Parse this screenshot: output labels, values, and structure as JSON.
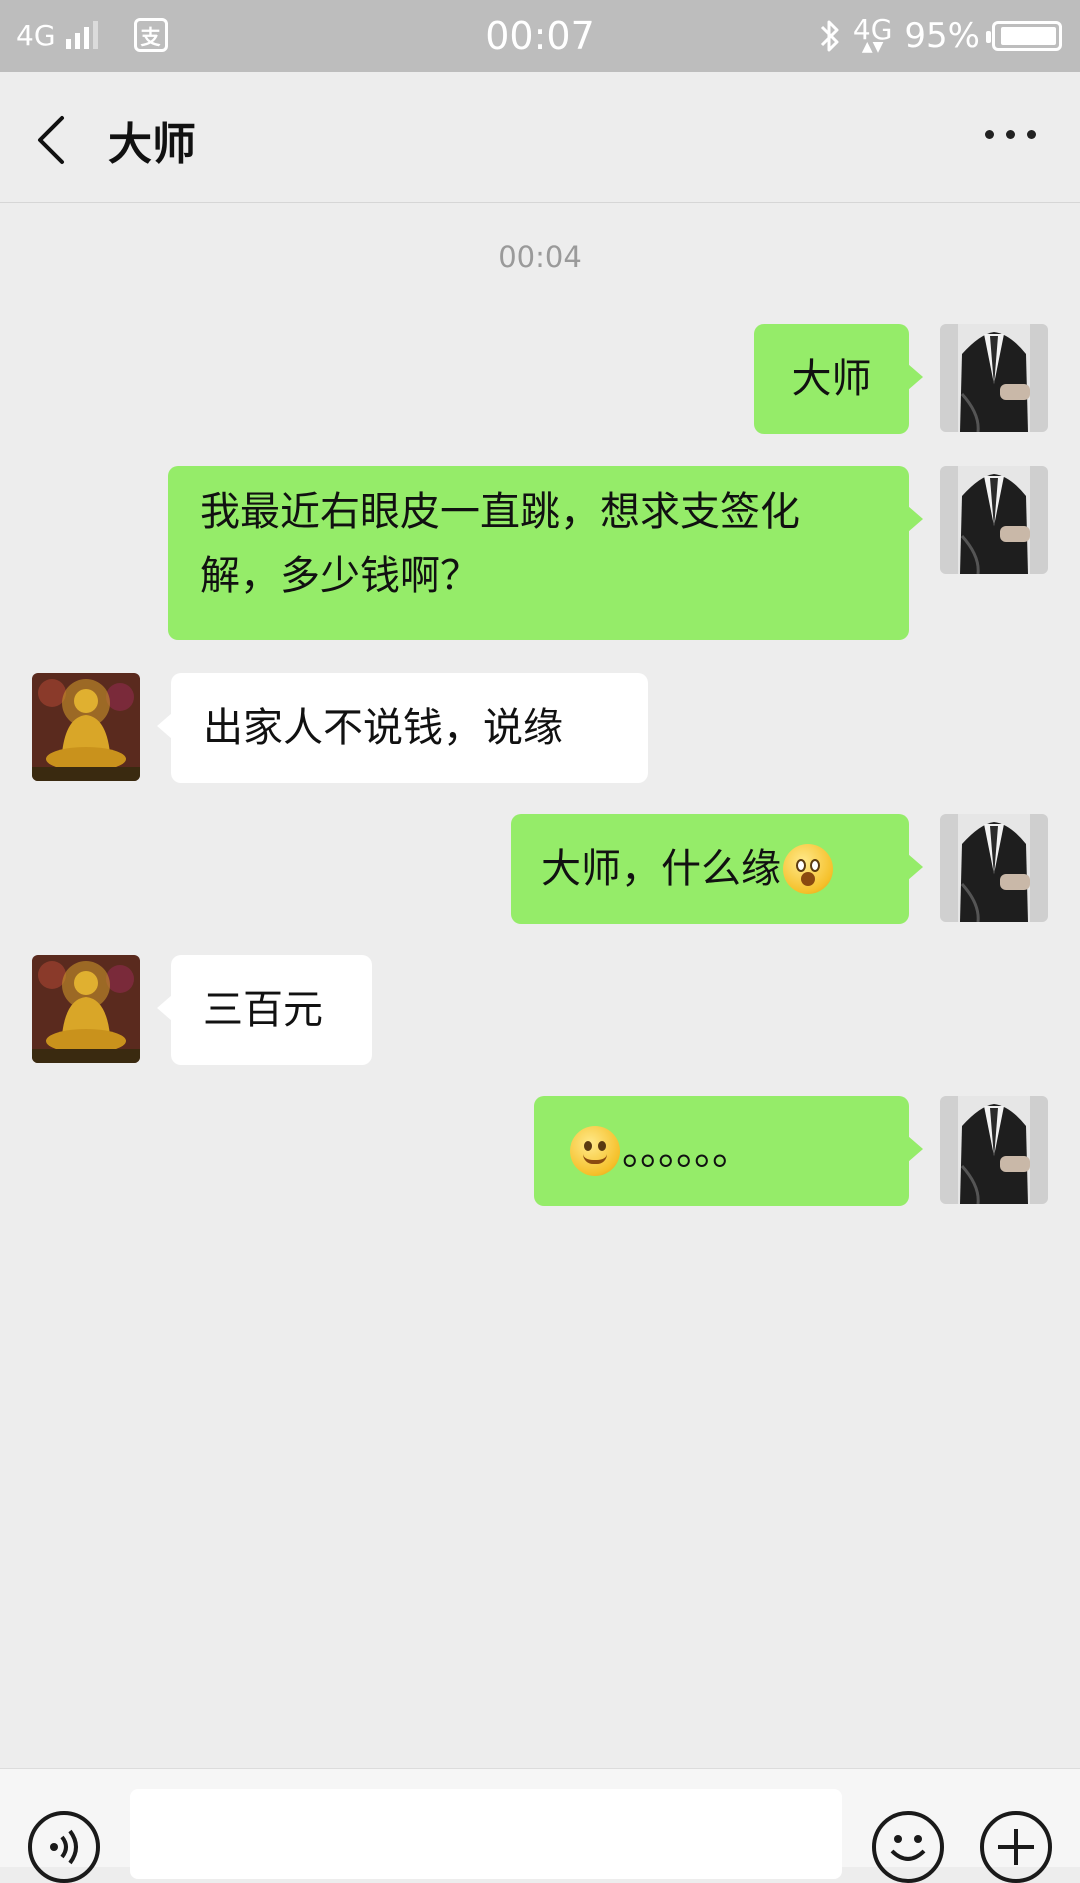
{
  "status_bar": {
    "network_left": "4G",
    "time": "00:07",
    "network_right": "4G",
    "battery_percent": "95%",
    "battery_level": 0.95,
    "icons": [
      "signal-icon",
      "alipay-icon",
      "bluetooth-icon",
      "battery-icon"
    ]
  },
  "header": {
    "back_icon": "chevron-left-icon",
    "title": "大师",
    "more_icon": "more-dots-icon"
  },
  "chat": {
    "timestamp": "00:04",
    "messages": [
      {
        "side": "right",
        "text": "大师"
      },
      {
        "side": "right",
        "text_line1": "我最近右眼皮一直跳，想求支签化",
        "text_line2": "解，多少钱啊？"
      },
      {
        "side": "left",
        "text": "出家人不说钱，说缘"
      },
      {
        "side": "right",
        "text": "大师，什么缘",
        "emoji": "surprised-emoji-icon"
      },
      {
        "side": "left",
        "text": "三百元"
      },
      {
        "side": "right",
        "emoji": "smile-emoji-icon",
        "text": "。。。。。。"
      }
    ]
  },
  "input_bar": {
    "voice_icon": "voice-icon",
    "input_value": "",
    "emoji_icon": "emoji-icon",
    "plus_icon": "plus-icon"
  },
  "colors": {
    "sent_bubble": "#95ec69",
    "received_bubble": "#ffffff",
    "background": "#ededed",
    "status_bar": "#bdbdbd"
  }
}
